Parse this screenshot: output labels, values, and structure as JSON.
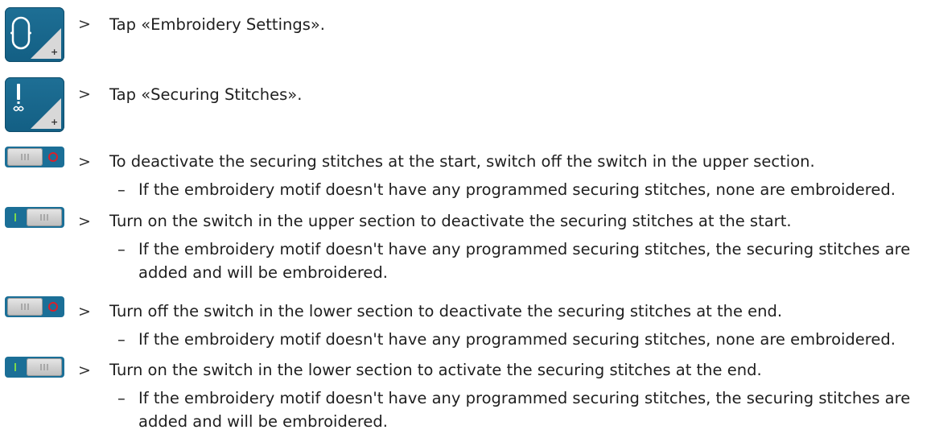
{
  "arrow": ">",
  "dash": "–",
  "steps": [
    {
      "icon": "embroidery-settings-icon",
      "text": "Tap «Embroidery Settings»."
    },
    {
      "icon": "securing-stitches-icon",
      "text": "Tap «Securing Stitches»."
    },
    {
      "icon": "switch-off-icon",
      "text": "To deactivate the securing stitches at the start, switch off the switch in the upper section.",
      "result": "If the embroidery motif doesn't have any programmed securing stitches, none are embroidered."
    },
    {
      "icon": "switch-on-icon",
      "text": "Turn on the switch in the upper section to deactivate the securing stitches at the start.",
      "result": "If the embroidery motif doesn't have any programmed securing stitches, the securing stitches are added and will be embroidered."
    },
    {
      "icon": "switch-off-icon",
      "text": "Turn off the switch in the lower section to deactivate the securing stitches at the end.",
      "result": "If the embroidery motif doesn't have any programmed securing stitches, none are embroidered."
    },
    {
      "icon": "switch-on-icon",
      "text": "Turn on the switch in the lower section to activate the securing stitches at the end.",
      "result": "If the embroidery motif doesn't have any programmed securing stitches, the securing stitches are added and will be embroidered."
    }
  ],
  "colors": {
    "tile": "#1b6f97",
    "switch_off_indicator": "#d9202a",
    "switch_on_indicator": "#7ad84c"
  }
}
